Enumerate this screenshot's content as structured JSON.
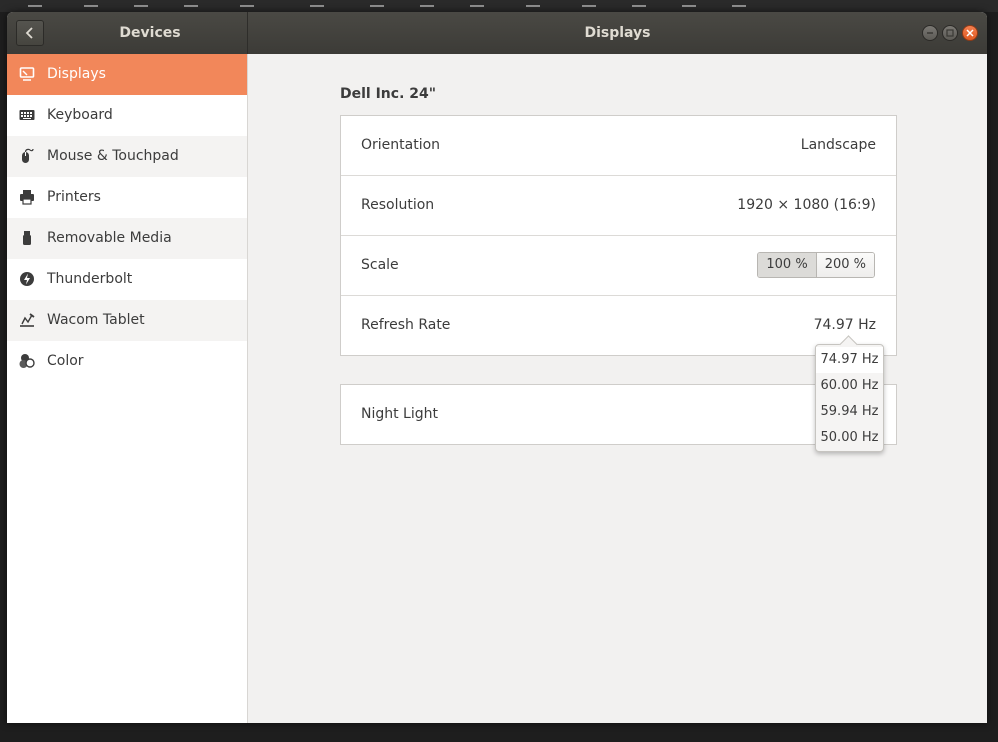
{
  "window": {
    "sidebar_title": "Devices",
    "main_title": "Displays"
  },
  "sidebar": {
    "items": [
      {
        "label": "Displays",
        "icon": "display-icon"
      },
      {
        "label": "Keyboard",
        "icon": "keyboard-icon"
      },
      {
        "label": "Mouse & Touchpad",
        "icon": "mouse-icon"
      },
      {
        "label": "Printers",
        "icon": "printer-icon"
      },
      {
        "label": "Removable Media",
        "icon": "usb-icon"
      },
      {
        "label": "Thunderbolt",
        "icon": "thunderbolt-icon"
      },
      {
        "label": "Wacom Tablet",
        "icon": "tablet-icon"
      },
      {
        "label": "Color",
        "icon": "color-icon"
      }
    ],
    "active_index": 0
  },
  "display": {
    "monitor_name": "Dell Inc. 24\"",
    "orientation": {
      "label": "Orientation",
      "value": "Landscape"
    },
    "resolution": {
      "label": "Resolution",
      "value": "1920 × 1080 (16:9)"
    },
    "scale": {
      "label": "Scale",
      "options": [
        "100 %",
        "200 %"
      ],
      "selected": "100 %"
    },
    "refresh_rate": {
      "label": "Refresh Rate",
      "value": "74.97 Hz"
    }
  },
  "night_light": {
    "label": "Night Light"
  },
  "refresh_popover": {
    "options": [
      "74.97 Hz",
      "60.00 Hz",
      "59.94 Hz",
      "50.00 Hz"
    ]
  },
  "colors": {
    "accent": "#f2875a",
    "titlebar": "#3c3b37",
    "close_button": "#e05a22"
  }
}
